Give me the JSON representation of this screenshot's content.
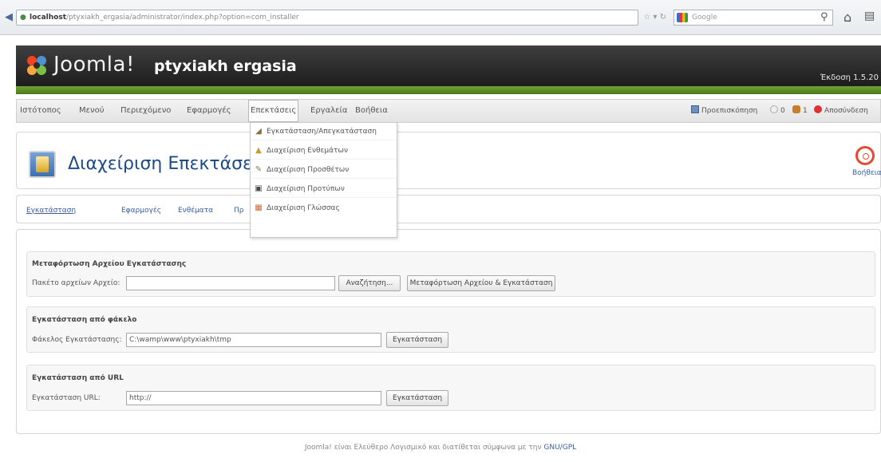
{
  "browser": {
    "url_host": "localhost",
    "url_path": "/ptyxiakh_ergasia/administrator/index.php?option=com_installer",
    "search_placeholder": "Google"
  },
  "header": {
    "logo_text": "Joomla!",
    "site_name": "ptyxiakh ergasia",
    "version": "Έκδοση 1.5.20"
  },
  "menu": {
    "items": [
      "Ιστότοπος",
      "Μενού",
      "Περιεχόμενο",
      "Εφαρμογές",
      "Επεκτάσεις",
      "Εργαλεία",
      "Βοήθεια"
    ],
    "active_index": 4
  },
  "status": {
    "preview": "Προεπισκόπηση",
    "messages": "0",
    "users": "1",
    "logout": "Αποσύνδεση"
  },
  "dropdown": {
    "items": [
      {
        "label": "Εγκατάσταση/Απεγκατάσταση",
        "icon": "install-icon",
        "color": "#8a6d3b"
      },
      {
        "label": "Διαχείριση Ενθεμάτων",
        "icon": "module-icon",
        "color": "#c99a2e"
      },
      {
        "label": "Διαχείριση Προσθέτων",
        "icon": "plugin-icon",
        "color": "#6a8f3a"
      },
      {
        "label": "Διαχείριση Προτύπων",
        "icon": "template-icon",
        "color": "#4a4a4a"
      },
      {
        "label": "Διαχείριση Γλώσσας",
        "icon": "language-icon",
        "color": "#c96a3a"
      }
    ]
  },
  "page": {
    "title": "Διαχείριση Επεκτάσεων",
    "help_label": "Βοήθεια"
  },
  "tabs": [
    "Εγκατάσταση",
    "Εφαρμογές",
    "Ενθέματα",
    "Πρ"
  ],
  "sections": {
    "upload": {
      "title": "Μεταφόρτωση Αρχείου Εγκατάστασης",
      "label": "Πακέτο αρχείων Αρχείο:",
      "value": "",
      "browse_label": "Αναζήτηση...",
      "submit_label": "Μεταφόρτωση Αρχείου & Εγκατάσταση"
    },
    "directory": {
      "title": "Εγκατάσταση από φάκελο",
      "label": "Φάκελος Εγκατάστασης:",
      "value": "C:\\wamp\\www\\ptyxiakh\\tmp",
      "submit_label": "Εγκατάσταση"
    },
    "url": {
      "title": "Εγκατάσταση από URL",
      "label": "Εγκατάσταση URL:",
      "value": "http://",
      "submit_label": "Εγκατάσταση"
    }
  },
  "footer": {
    "text": "Joomla! είναι Ελεύθερο Λογισμικό και διατίθεται σύμφωνα με την",
    "link": "GNU/GPL"
  }
}
